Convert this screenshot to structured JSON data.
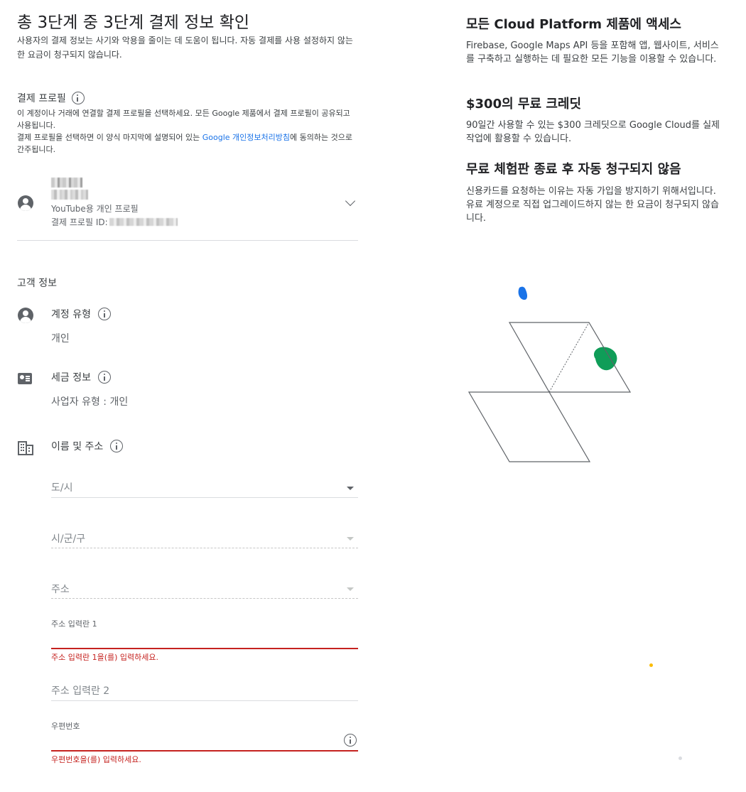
{
  "header": {
    "title": "총 3단계 중 3단계 결제 정보 확인",
    "description": "사용자의 결제 정보는 사기와 악용을 줄이는 데 도움이 됩니다. 자동 결제를 사용 설정하지 않는 한 요금이 청구되지 않습니다."
  },
  "billing_profile": {
    "heading": "결제 프로필",
    "desc_line1": "이 계정이나 거래에 연결할 결제 프로필을 선택하세요. 모든 Google 제품에서 결제 프로필이 공유되고 사용됩니다.",
    "desc_line2_before": "결제 프로필을 선택하면 이 양식 마지막에 설명되어 있는 ",
    "desc_line2_link": "Google 개인정보처리방침",
    "desc_line2_after": "에 동의하는 것으로 간주됩니다.",
    "profile_type": "YouTube용 개인 프로필",
    "profile_id_label": "결제 프로필 ID:"
  },
  "customer_info": {
    "heading": "고객 정보",
    "account_type_label": "계정 유형",
    "account_type_value": "개인",
    "tax_label": "세금 정보",
    "tax_value": "사업자 유형 : 개인",
    "name_address_label": "이름 및 주소",
    "fields": {
      "province_placeholder": "도/시",
      "city_placeholder": "시/군/구",
      "address_placeholder": "주소",
      "address1_label": "주소 입력란 1",
      "address1_error": "주소 입력란 1을(를) 입력하세요.",
      "address2_placeholder": "주소 입력란 2",
      "postal_label": "우편번호",
      "postal_error": "우편번호을(를) 입력하세요."
    }
  },
  "sidebar": {
    "h1_prefix": "모든 ",
    "h1_bold": "Cloud Platform",
    "h1_suffix": " 제품에 액세스",
    "p1": "Firebase, Google Maps API 등을 포함해 앱, 웹사이트, 서비스를 구축하고 실행하는 데 필요한 모든 기능을 이용할 수 있습니다.",
    "h2_bold": "$300",
    "h2_suffix": "의 무료 크레딧",
    "p2": "90일간 사용할 수 있는 $300 크레딧으로 Google Cloud를 실제 작업에 활용할 수 있습니다.",
    "h3": "무료 체험판 종료 후 자동 청구되지 않음",
    "p3": "신용카드를 요청하는 이유는 자동 가입을 방지하기 위해서입니다. 유료 계정으로 직접 업그레이드하지 않는 한 요금이 청구되지 않습니다."
  },
  "colors": {
    "accent_blue": "#1a73e8",
    "error_red": "#c5221f",
    "illustration_blue": "#1a73e8",
    "illustration_green": "#0f9d58",
    "illustration_yellow": "#fbbc04"
  }
}
